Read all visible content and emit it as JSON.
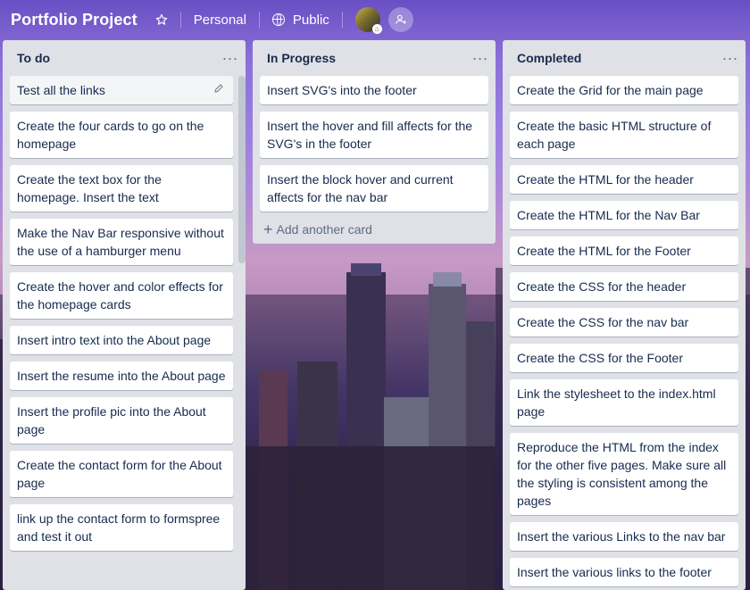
{
  "header": {
    "title": "Portfolio Project",
    "team": "Personal",
    "visibility": "Public",
    "star_icon": "star-icon",
    "visibility_icon": "globe-icon",
    "invite_icon": "add-member-icon"
  },
  "colors": {
    "list_bg": "#dfe1e6",
    "card_bg": "#ffffff",
    "text": "#172b4d",
    "muted": "#5e6c84"
  },
  "lists": [
    {
      "title": "To do",
      "cards": [
        "Test all the links",
        "Create the four cards to go on the homepage",
        "Create the text box for the homepage. Insert the text",
        "Make the Nav Bar responsive without the use of a hamburger menu",
        "Create the hover and color effects for the homepage cards",
        "Insert intro text into the About page",
        "Insert the resume into the About page",
        "Insert the profile pic into the About page",
        "Create the contact form for the About page",
        "link up the contact form to formspree and test it out"
      ]
    },
    {
      "title": "In Progress",
      "cards": [
        "Insert SVG's into the footer",
        "Insert the hover and fill affects for the SVG's in the footer",
        "Insert the block hover and current affects for the nav bar"
      ],
      "add_card": "Add another card"
    },
    {
      "title": "Completed",
      "cards": [
        "Create the Grid for the main page",
        "Create the basic HTML structure of each page",
        "Create the HTML for the header",
        "Create the HTML for the Nav Bar",
        "Create the HTML for the Footer",
        "Create the CSS for the header",
        "Create the CSS for the nav bar",
        "Create the CSS for the Footer",
        "Link the stylesheet to the index.html page",
        "Reproduce the HTML from the index for the other five pages. Make sure all the styling is consistent among the pages",
        "Insert the various Links to the nav bar",
        "Insert the various links to the footer"
      ]
    }
  ]
}
